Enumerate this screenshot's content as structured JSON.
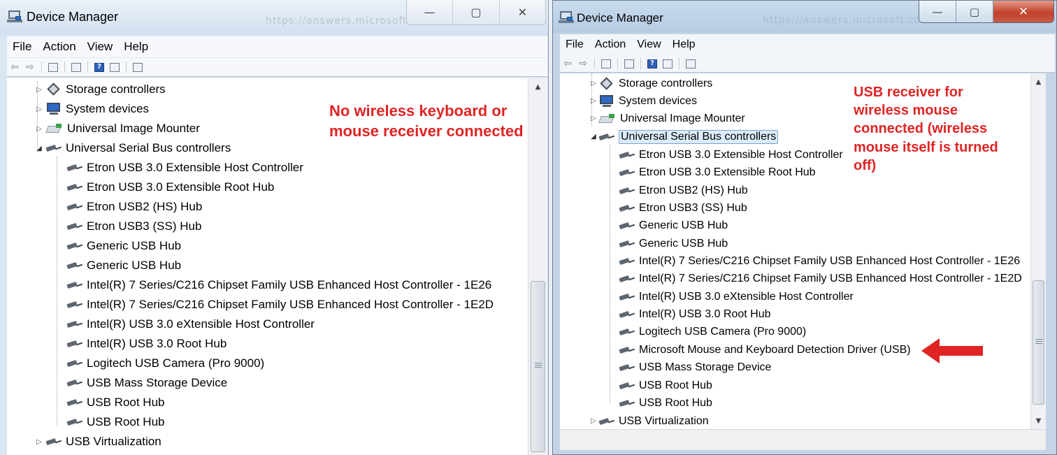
{
  "left_window": {
    "title": "Device Manager",
    "ghost_url": "https://answers.microsoft.com",
    "controls": {
      "minimize": "—",
      "maximize": "▢",
      "close": "✕"
    },
    "menu": [
      "File",
      "Action",
      "View",
      "Help"
    ],
    "annotation": "No wireless keyboard or mouse receiver connected",
    "tree": {
      "categories_before": [
        {
          "label": "Storage controllers",
          "icon": "storage-icon"
        },
        {
          "label": "System devices",
          "icon": "system-devices-icon"
        },
        {
          "label": "Universal Image Mounter",
          "icon": "image-mounter-icon"
        }
      ],
      "usb_category": "Universal Serial Bus controllers",
      "usb_children": [
        "Etron USB 3.0 Extensible Host Controller",
        "Etron USB 3.0 Extensible Root Hub",
        "Etron USB2 (HS) Hub",
        "Etron USB3 (SS) Hub",
        "Generic USB Hub",
        "Generic USB Hub",
        "Intel(R) 7 Series/C216 Chipset Family USB Enhanced Host Controller - 1E26",
        "Intel(R) 7 Series/C216 Chipset Family USB Enhanced Host Controller - 1E2D",
        "Intel(R) USB 3.0 eXtensible Host Controller",
        "Intel(R) USB 3.0 Root Hub",
        "Logitech USB Camera (Pro 9000)",
        "USB Mass Storage Device",
        "USB Root Hub",
        "USB Root Hub"
      ],
      "after": "USB Virtualization"
    }
  },
  "right_window": {
    "title": "Device Manager",
    "ghost_url": "https://answers.microsoft.com",
    "controls": {
      "minimize": "—",
      "maximize": "▢",
      "close": "✕"
    },
    "menu": [
      "File",
      "Action",
      "View",
      "Help"
    ],
    "annotation": "USB receiver for wireless mouse connected (wireless mouse itself is turned off)",
    "tree": {
      "categories_before": [
        {
          "label": "Storage controllers",
          "icon": "storage-icon"
        },
        {
          "label": "System devices",
          "icon": "system-devices-icon"
        },
        {
          "label": "Universal Image Mounter",
          "icon": "image-mounter-icon"
        }
      ],
      "usb_category": "Universal Serial Bus controllers",
      "usb_children": [
        "Etron USB 3.0 Extensible Host Controller",
        "Etron USB 3.0 Extensible Root Hub",
        "Etron USB2 (HS) Hub",
        "Etron USB3 (SS) Hub",
        "Generic USB Hub",
        "Generic USB Hub",
        "Intel(R) 7 Series/C216 Chipset Family USB Enhanced Host Controller - 1E26",
        "Intel(R) 7 Series/C216 Chipset Family USB Enhanced Host Controller - 1E2D",
        "Intel(R) USB 3.0 eXtensible Host Controller",
        "Intel(R) USB 3.0 Root Hub",
        "Logitech USB Camera (Pro 9000)",
        "Microsoft Mouse and Keyboard Detection Driver (USB)",
        "USB Mass Storage Device",
        "USB Root Hub",
        "USB Root Hub"
      ],
      "after": "USB Virtualization",
      "highlighted_child": "Microsoft Mouse and Keyboard Detection Driver (USB)"
    }
  },
  "colors": {
    "annotation_red": "#e02424",
    "selection_bg": "#dcecfc",
    "close_red": "#c2412a"
  }
}
